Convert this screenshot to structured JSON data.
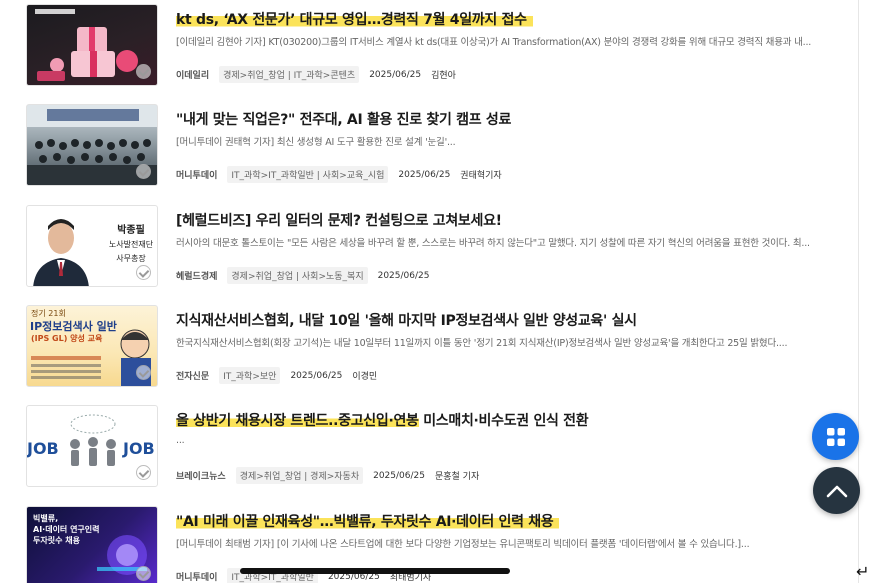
{
  "articles": [
    {
      "title": "kt ds, ‘AX 전문가’ 대규모 영입…경력직 7월 4일까지 접수",
      "summary": "[이데일리 김현아 기자] KT(030200)그룹의 IT서비스 계열사 kt ds(대표 이상국)가 AI Transformation(AX) 분야의 경쟁력 강화를 위해 대규모 경력직 채용과 내...",
      "source": "이데일리",
      "category": "경제>취업_창업 | IT_과학>콘텐츠",
      "date": "2025/06/25",
      "writer": "김현아",
      "thumb_text": "",
      "thumb_name": "pink-gift-boxes-image"
    },
    {
      "title": "\"내게 맞는 직업은?\" 전주대, AI 활용 진로 찾기 캠프 성료",
      "summary": "[머니투데이 권태혁 기자] 최신 생성형 AI 도구 활용한 진로 설계 '눈길'...",
      "source": "머니투데이",
      "category": "IT_과학>IT_과학일반 | 사회>교육_시험",
      "date": "2025/06/25",
      "writer": "권태혁기자",
      "thumb_text": "",
      "thumb_name": "group-photo-image"
    },
    {
      "title": "[헤럴드비즈] 우리 일터의 문제? 컨설팅으로 고쳐보세요!",
      "summary": "러시아의 대문호 톨스토이는 \"모든 사람은 세상을 바꾸려 할 뿐, 스스로는 바꾸려 하지 않는다\"고 말했다. 지기 성찰에 따른 자기 혁신의 어려움을 표현한 것이다. 최...",
      "source": "헤럴드경제",
      "category": "경제>취업_창업 | 사회>노동_복지",
      "date": "2025/06/25",
      "writer": "",
      "thumb_text": "",
      "thumb_name": "portrait-photo-image",
      "thumb_caption": [
        "박종필",
        "노사발전재단",
        "사무총장"
      ]
    },
    {
      "title": "지식재산서비스협회, 내달 10일 '올해 마지막 IP정보검색사 일반 양성교육' 실시",
      "summary": "한국지식재산서비스협회(회장 고기석)는 내달 10일부터 11일까지 이틀 동안 '정기 21회 지식재산(IP)정보검색사 일반 양성교육'을 개최한다고 25일 밝혔다....",
      "source": "전자신문",
      "category": "IT_과학>보안",
      "date": "2025/06/25",
      "writer": "이경민",
      "thumb_name": "ip-poster-image",
      "thumb_caption": [
        "정기 21회",
        "IP정보검색사 일반",
        "(IPS GL) 양성 교육"
      ]
    },
    {
      "title_highlight": "올 상반기 채용시장 트렌드..중고신입·연봉",
      "title_rest": " 미스매치·비수도권 인식 전환",
      "summary": "...",
      "source": "브레이크뉴스",
      "category": "경제>취업_창업 | 경제>자동차",
      "date": "2025/06/25",
      "writer": "문홍철 기자",
      "thumb_name": "job-figures-image",
      "thumb_caption": [
        "JOB",
        "JOB"
      ]
    },
    {
      "title": "\"AI 미래 이끌 인재육성\"…빅밸류, 두자릿수 AI·데이터 인력 채용",
      "summary": "[머니투데이 최태범 기자] [이 기사에 나온 스타트업에 대한 보다 다양한 기업정보는 유니콘팩토리 빅데이터 플랫폼 '데이터랩'에서 볼 수 있습니다.]...",
      "source": "머니투데이",
      "category": "IT_과학>IT_과학일반",
      "date": "2025/06/25",
      "writer": "최태범기자",
      "thumb_name": "ai-recruit-banner-image",
      "thumb_caption": [
        "빅밸류,",
        "AI·데이터 연구인력",
        "두자릿수 채용"
      ]
    }
  ],
  "fab": {
    "grid_icon": "grid-icon",
    "up_icon": "chevron-up-icon"
  }
}
